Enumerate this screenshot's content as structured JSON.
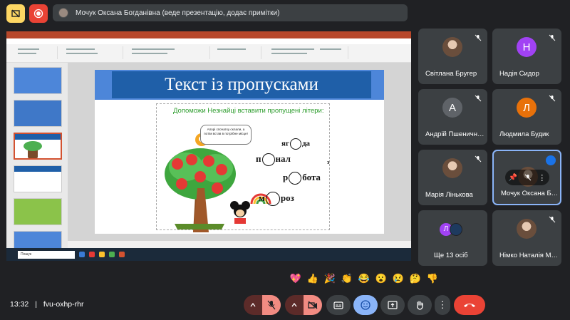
{
  "presenter_bar": {
    "text": "Мочук Оксана Богданівна (веде презентацію, додає примітки)"
  },
  "slide": {
    "title": "Текст із пропусками",
    "subtitle": "Допоможи Незнайці вставити пропущені літери:",
    "bubble": "Апорі спочатку склали, а потім встав в потрібне місце!",
    "words": [
      {
        "pre": "яг",
        "post": "да"
      },
      {
        "pre": "п",
        "post": "нал"
      },
      {
        "pre": "р",
        "post": "бота"
      },
      {
        "pre": "м",
        "post": "роз"
      }
    ],
    "extra_letter": "з"
  },
  "participants": [
    {
      "name": "Світлана Бругер",
      "avatar": "photo"
    },
    {
      "name": "Надія Сидор",
      "avatar": "Н",
      "color": "#a142f4"
    },
    {
      "name": "Андрій Пшеничн…",
      "avatar": "А",
      "color": "#5f6368"
    },
    {
      "name": "Людмила Будик",
      "avatar": "Л",
      "color": "#e8710a"
    },
    {
      "name": "Марія Лінькова",
      "avatar": "photo"
    },
    {
      "name": "Мочук Оксана Б…",
      "avatar": "photo"
    },
    {
      "name": "Ще 13 осіб",
      "avatar": "Л"
    },
    {
      "name": "Німко Наталія М…",
      "avatar": "photo"
    }
  ],
  "footer": {
    "time": "13:32",
    "separator": "|",
    "meeting_code": "fvu-oxhp-rhr"
  },
  "reactions": [
    "💖",
    "👍",
    "🎉",
    "👏",
    "😂",
    "😮",
    "😢",
    "🤔",
    "👎"
  ],
  "colors": {
    "accent": "#8ab4f8",
    "danger": "#ea4335",
    "muted_red": "#f28b82",
    "tile": "#3c4043"
  },
  "taskbar": {
    "search_placeholder": "Пошук"
  }
}
